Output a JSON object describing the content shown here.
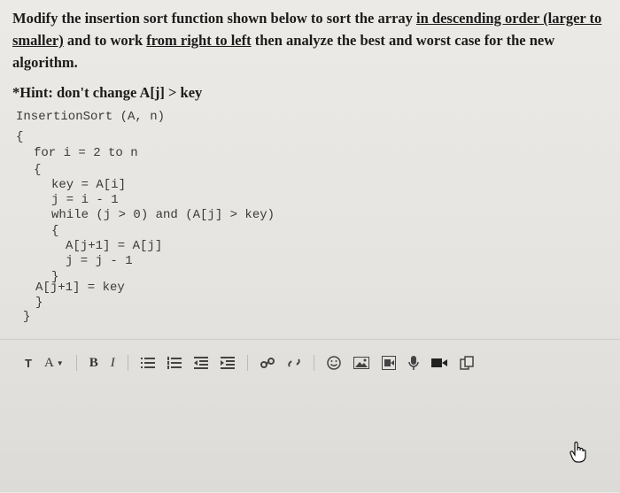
{
  "question": {
    "p1": "Modify the insertion sort function shown below to sort the array ",
    "u1": "in descending order (larger to smaller)",
    "p2": " and to work ",
    "u2": "from right to left",
    "p3": " then analyze the best and worst case for the new algorithm."
  },
  "hint": "*Hint: don't change A[j] > key",
  "code": [
    "InsertionSort (A, n)",
    "{",
    "for i = 2 to n",
    "{",
    "key = A[i]",
    "j = i - 1",
    "while (j > 0) and (A[j] > key)",
    "{",
    "A[j+1] = A[j]",
    "j = j - 1",
    "}",
    "A[j+1] = key",
    "}",
    "}"
  ],
  "toolbar": {
    "paragraph_label": "T",
    "font_label": "A",
    "bold_label": "B",
    "italic_label": "I"
  },
  "icons": [
    "paragraph-style-icon",
    "font-color-icon",
    "bold-icon",
    "italic-icon",
    "unordered-list-icon",
    "ordered-list-icon",
    "outdent-icon",
    "indent-icon",
    "link-icon",
    "unlink-icon",
    "emoji-icon",
    "image-icon",
    "media-icon",
    "microphone-icon",
    "video-icon",
    "copy-icon"
  ]
}
